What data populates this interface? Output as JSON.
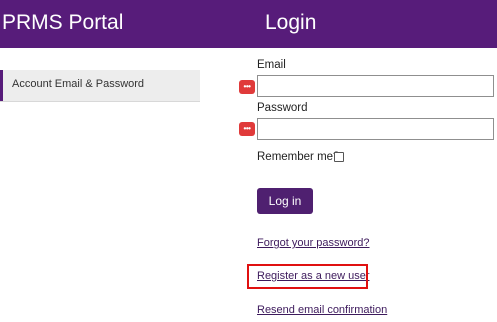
{
  "header": {
    "portal_title": "PRMS Portal",
    "page_title": "Login",
    "background_color": "#571c7a"
  },
  "sidebar": {
    "items": [
      {
        "label": "Account Email & Password",
        "active": true
      }
    ]
  },
  "form": {
    "email_label": "Email",
    "email_value": "",
    "password_label": "Password",
    "password_value": "",
    "password_manager_icon": "password-manager-icon",
    "remember_label": "Remember me?",
    "remember_checked": false,
    "submit_label": "Log in"
  },
  "links": {
    "forgot_password": "Forgot your password?",
    "register": "Register as a new user",
    "resend_confirmation": "Resend email confirmation"
  },
  "highlight_color": "#e01010"
}
